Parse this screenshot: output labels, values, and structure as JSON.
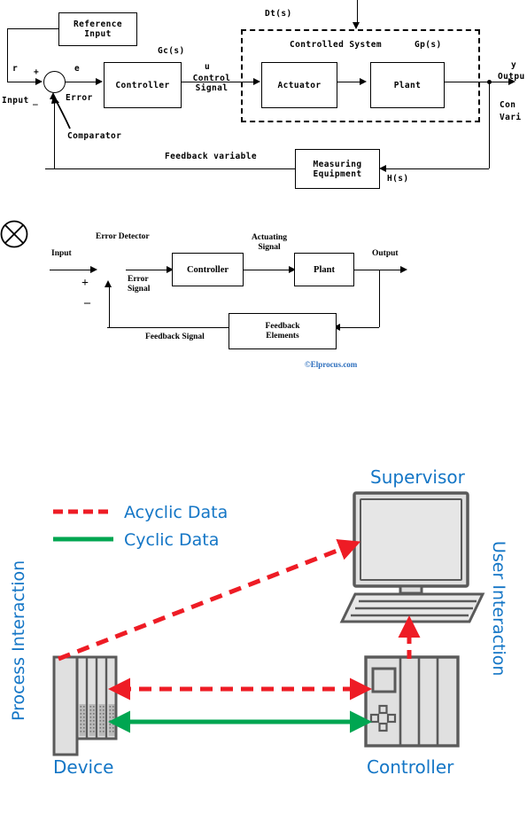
{
  "figure1": {
    "name": "closed-loop-control-system-block-diagram",
    "boxes": {
      "reference_input": "Reference\nInput",
      "controller": "Controller",
      "actuator": "Actuator",
      "plant": "Plant",
      "measuring_equipment": "Measuring\nEquipment"
    },
    "labels": {
      "r": "r",
      "plus": "+",
      "minus": "_",
      "input": "Input",
      "e": "e",
      "error": "Error",
      "comparator": "Comparator",
      "gc": "Gc(s)",
      "u": "u",
      "control_signal": "Control\nSignal",
      "dt": "Dt(s)",
      "controlled_system": "Controlled System",
      "gp": "Gp(s)",
      "y": "y",
      "output": "Outpu",
      "controlled_var_1": "Con",
      "controlled_var_2": "Vari",
      "feedback_variable": "Feedback variable",
      "hs": "H(s)"
    }
  },
  "figure2": {
    "name": "closed-loop-feedback-control-system",
    "boxes": {
      "controller": "Controller",
      "plant": "Plant",
      "feedback_elements": "Feedback\nElements"
    },
    "labels": {
      "input": "Input",
      "error_detector": "Error Detector",
      "plus": "+",
      "minus": "–",
      "error_signal": "Error\nSignal",
      "actuating_signal": "Actuating\nSignal",
      "output": "Output",
      "feedback_signal": "Feedback Signal"
    },
    "watermark": "©Elprocus.com"
  },
  "figure3": {
    "name": "cyclic-acyclic-data-exchange-diagram",
    "legend": [
      {
        "label": "Acyclic Data",
        "style": "dashed",
        "color": "#ee1c25"
      },
      {
        "label": "Cyclic Data",
        "style": "solid",
        "color": "#00a651"
      }
    ],
    "labels": {
      "supervisor": "Supervisor",
      "device": "Device",
      "controller": "Controller",
      "process_interaction": "Process Interaction",
      "user_interaction": "User Interaction"
    },
    "colors": {
      "text_blue": "#1476c6",
      "acyclic_red": "#ee1c25",
      "cyclic_green": "#00a651",
      "device_fill": "#e0e0e0",
      "device_stroke": "#5a5a5a"
    }
  }
}
